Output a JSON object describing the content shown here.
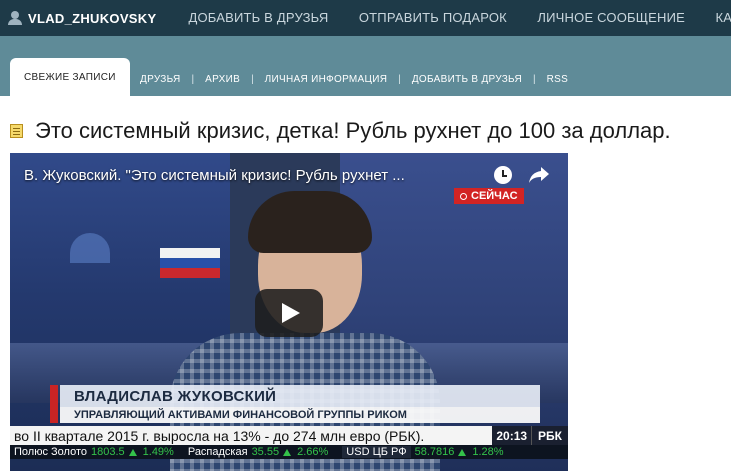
{
  "topbar": {
    "username": "VLAD_ZHUKOVSKY",
    "nav": [
      {
        "label": "ДОБАВИТЬ В ДРУЗЬЯ"
      },
      {
        "label": "ОТПРАВИТЬ ПОДАРОК"
      },
      {
        "label": "ЛИЧНОЕ СООБЩЕНИЕ"
      },
      {
        "label": "КАЛЕНДАРЬ"
      }
    ]
  },
  "subbar": {
    "active_tab": "СВЕЖИЕ ЗАПИСИ",
    "items": [
      {
        "label": "ДРУЗЬЯ"
      },
      {
        "label": "АРХИВ"
      },
      {
        "label": "ЛИЧНАЯ ИНФОРМАЦИЯ"
      },
      {
        "label": "ДОБАВИТЬ В ДРУЗЬЯ"
      },
      {
        "label": "RSS"
      }
    ],
    "separator": "|"
  },
  "post": {
    "title": "Это системный кризис, детка! Рубль рухнет до 100 за доллар."
  },
  "video": {
    "title": "В. Жуковский. \"Это системный кризис! Рубль рухнет ...",
    "live_label": "СЕЙЧАС",
    "name": "ВЛАДИСЛАВ ЖУКОВСКИЙ",
    "role": "УПРАВЛЯЮЩИЙ АКТИВАМИ ФИНАНСОВОЙ ГРУППЫ РИКОМ",
    "ticker": "во II квартале 2015 г. выросла на 13% - до 274 млн евро (РБК).",
    "time": "20:13",
    "channel": "РБК",
    "quotes": {
      "gold_label": "Полюс Золото",
      "gold_value": "1803.5",
      "gold_change": "1.49%",
      "raspad_label": "Распадская",
      "raspad_value": "35.55",
      "raspad_change": "2.66%",
      "usd_label": "USD ЦБ РФ",
      "usd_value": "58.7816",
      "usd_change": "1.28%"
    }
  },
  "colors": {
    "topbar": "#1e3a48",
    "subbar": "#5f8b98",
    "live_red": "#d22424",
    "quote_up": "#34c24a"
  }
}
